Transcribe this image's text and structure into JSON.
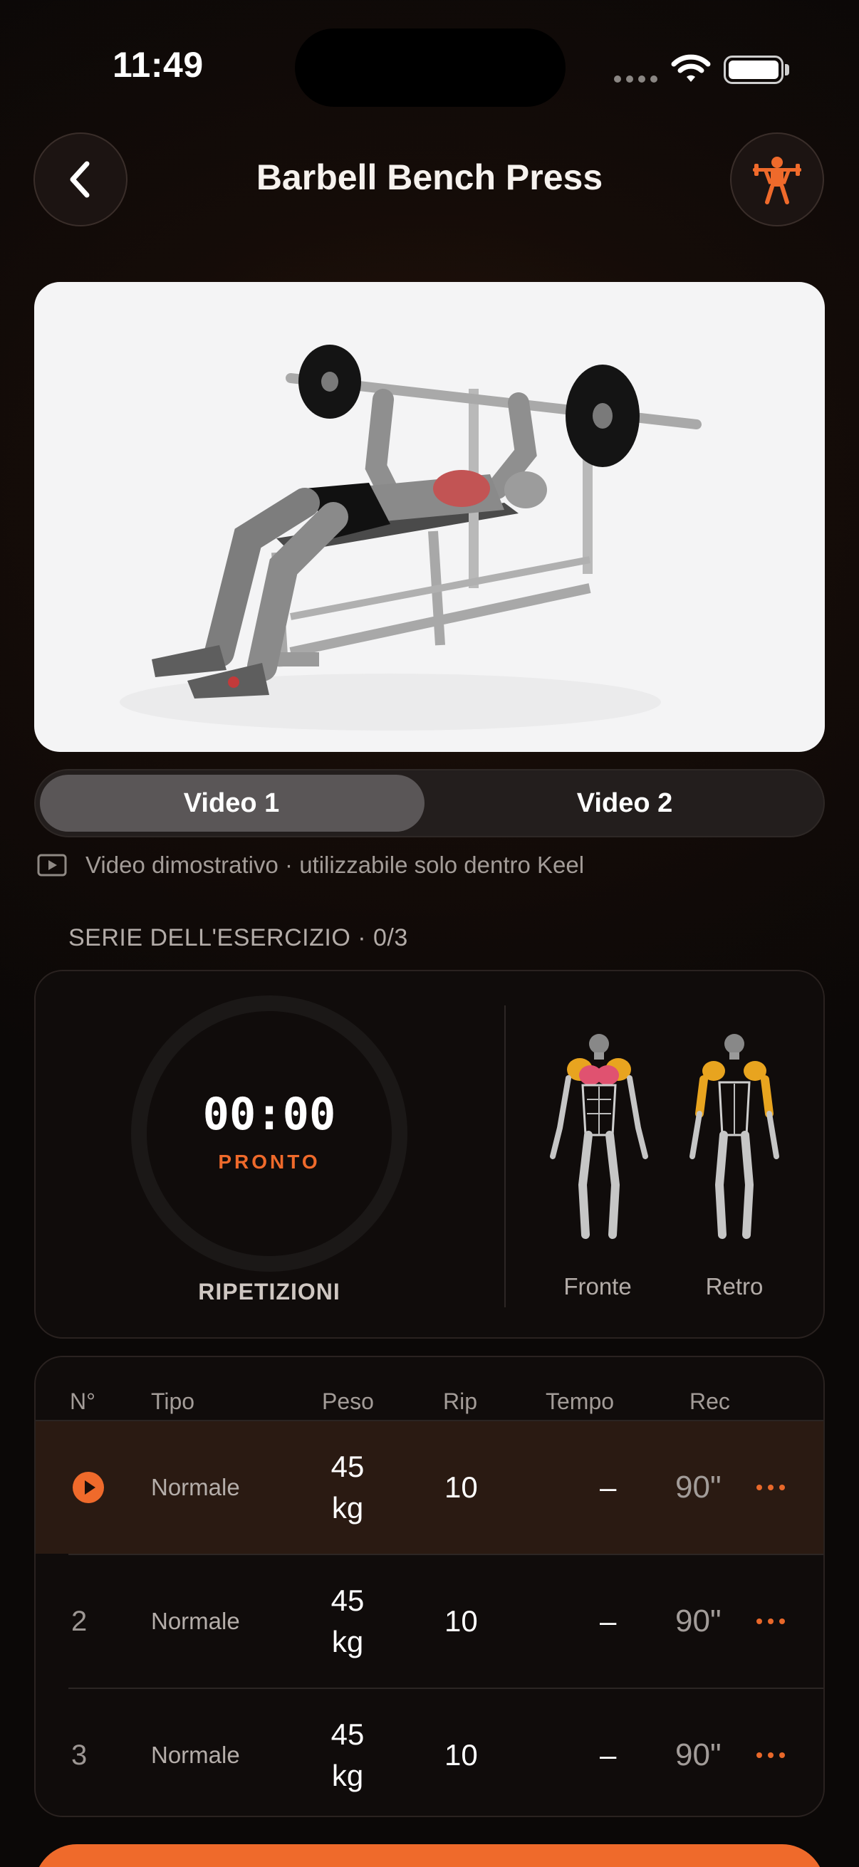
{
  "status": {
    "time": "11:49"
  },
  "header": {
    "title": "Barbell Bench Press",
    "back_icon": "chevron-left-icon",
    "equipment_icon": "weightlifter-icon",
    "accent": "#ef6a2b"
  },
  "video": {
    "tabs": [
      {
        "label": "Video 1",
        "active": true
      },
      {
        "label": "Video 2",
        "active": false
      }
    ],
    "note": "Video dimostrativo · utilizzabile solo dentro Keel"
  },
  "series": {
    "section_title": "SERIE DELL'ESERCIZIO · 0/3",
    "timer": "00:00",
    "timer_status": "PRONTO",
    "mode_label": "RIPETIZIONI",
    "front_label": "Fronte",
    "back_label": "Retro"
  },
  "table": {
    "headers": {
      "num": "N°",
      "tipo": "Tipo",
      "peso": "Peso",
      "rip": "Rip",
      "tempo": "Tempo",
      "rec": "Rec"
    },
    "rows": [
      {
        "num": "",
        "tipo": "Normale",
        "peso_value": "45",
        "peso_unit": "kg",
        "rip": "10",
        "tempo": "–",
        "rec": "90\"",
        "active": true
      },
      {
        "num": "2",
        "tipo": "Normale",
        "peso_value": "45",
        "peso_unit": "kg",
        "rip": "10",
        "tempo": "–",
        "rec": "90\"",
        "active": false
      },
      {
        "num": "3",
        "tipo": "Normale",
        "peso_value": "45",
        "peso_unit": "kg",
        "rip": "10",
        "tempo": "–",
        "rec": "90\"",
        "active": false
      }
    ]
  }
}
